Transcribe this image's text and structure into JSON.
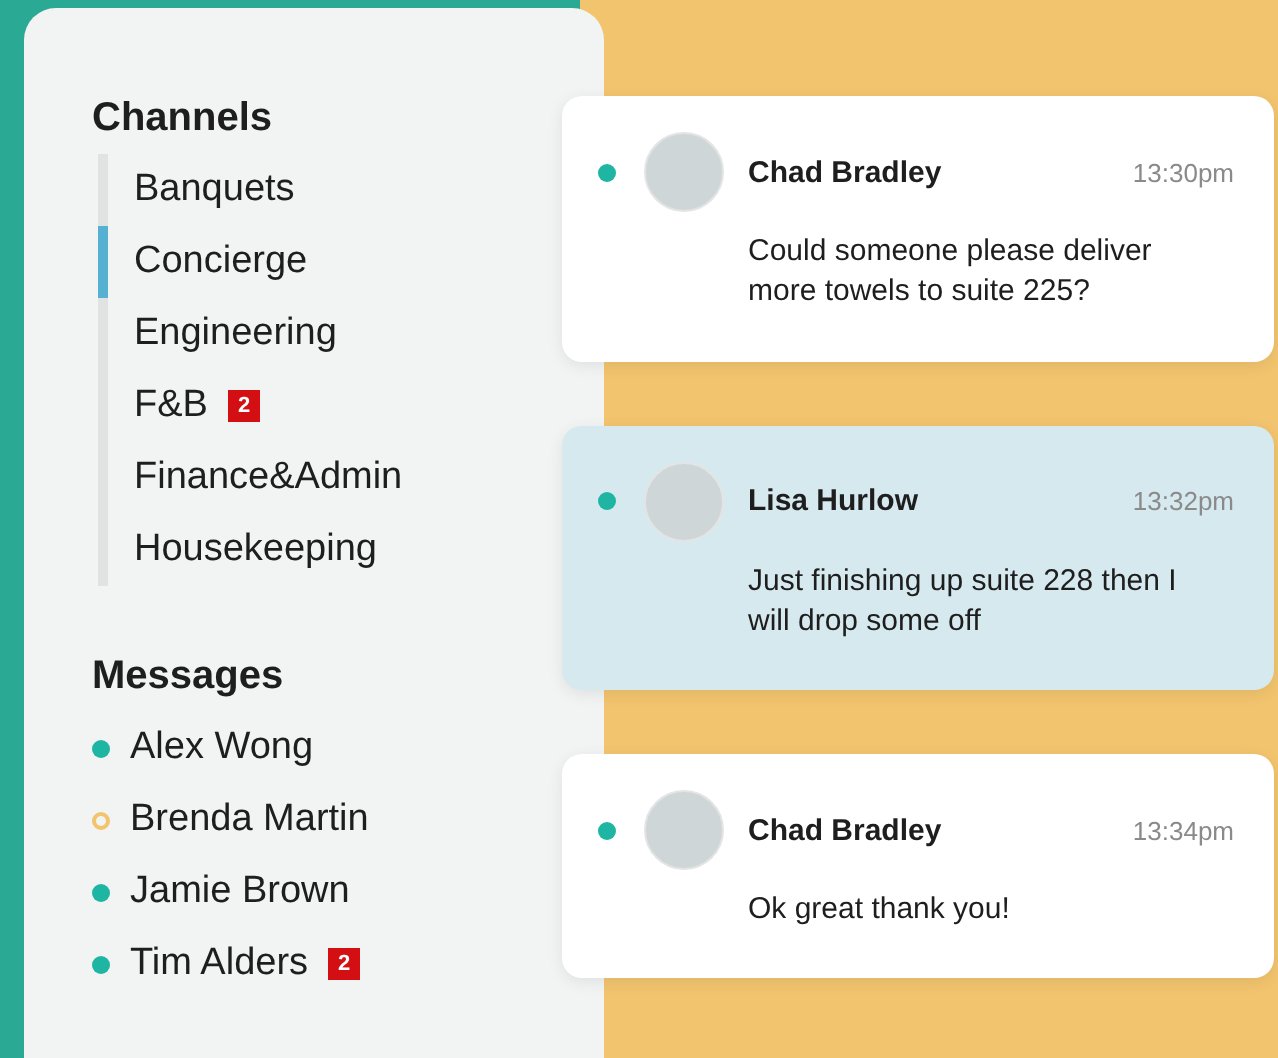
{
  "channels": {
    "title": "Channels",
    "items": [
      {
        "label": "Banquets",
        "selected": false
      },
      {
        "label": "Concierge",
        "selected": true
      },
      {
        "label": "Engineering",
        "selected": false
      },
      {
        "label": "F&B",
        "selected": false,
        "badge": "2"
      },
      {
        "label": "Finance&Admin",
        "selected": false
      },
      {
        "label": "Housekeeping",
        "selected": false
      }
    ]
  },
  "messages": {
    "title": "Messages",
    "items": [
      {
        "name": "Alex Wong",
        "online": true
      },
      {
        "name": "Brenda Martin",
        "online": false
      },
      {
        "name": "Jamie Brown",
        "online": true
      },
      {
        "name": "Tim Alders",
        "online": true,
        "badge": "2"
      }
    ]
  },
  "chat": [
    {
      "sender": "Chad Bradley",
      "time": "13:30pm",
      "text": "Could someone please deliver more towels to suite 225?",
      "online": true,
      "selected": false
    },
    {
      "sender": "Lisa Hurlow",
      "time": "13:32pm",
      "text": "Just finishing up suite 228 then I will drop some off",
      "online": true,
      "selected": true
    },
    {
      "sender": "Chad Bradley",
      "time": "13:34pm",
      "text": "Ok great thank you!",
      "online": true,
      "selected": false
    }
  ]
}
